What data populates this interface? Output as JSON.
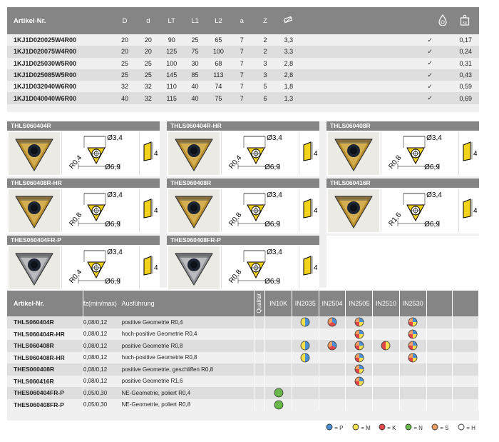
{
  "top_table": {
    "headers": [
      "Artikel-Nr.",
      "D",
      "d",
      "LT",
      "L1",
      "L2",
      "a",
      "Z"
    ],
    "rows": [
      [
        "1KJ1D020025W4R00",
        "20",
        "20",
        "90",
        "25",
        "65",
        "7",
        "2",
        "3,3",
        "✓",
        "0,17"
      ],
      [
        "1KJ1D020075W4R00",
        "20",
        "20",
        "125",
        "75",
        "100",
        "7",
        "2",
        "3,3",
        "✓",
        "0,24"
      ],
      [
        "1KJ1D025030W5R00",
        "25",
        "25",
        "100",
        "30",
        "68",
        "7",
        "3",
        "2,8",
        "✓",
        "0,31"
      ],
      [
        "1KJ1D025085W5R00",
        "25",
        "25",
        "145",
        "85",
        "113",
        "7",
        "3",
        "2,8",
        "✓",
        "0,43"
      ],
      [
        "1KJ1D032040W6R00",
        "32",
        "32",
        "110",
        "40",
        "74",
        "7",
        "5",
        "1,8",
        "✓",
        "0,59"
      ],
      [
        "1KJ1D040040W6R00",
        "40",
        "32",
        "115",
        "40",
        "75",
        "7",
        "6",
        "1,3",
        "✓",
        "0,69"
      ]
    ],
    "weight_icon_label": "kg"
  },
  "inserts": [
    {
      "name": "THLS060404R",
      "radius": "R0,4",
      "d1": "Ø3,4",
      "d2": "Ø6,9",
      "h": "4",
      "coating": "gold"
    },
    {
      "name": "THLS060404R-HR",
      "radius": "R0,4",
      "d1": "Ø3,4",
      "d2": "Ø6,9",
      "h": "4",
      "coating": "gold"
    },
    {
      "name": "THLS060408R",
      "radius": "R0,8",
      "d1": "Ø3,4",
      "d2": "Ø6,9",
      "h": "4",
      "coating": "gold"
    },
    {
      "name": "THLS060408R-HR",
      "radius": "R0,8",
      "d1": "Ø3,4",
      "d2": "Ø6,9",
      "h": "4",
      "coating": "gold"
    },
    {
      "name": "THES060408R",
      "radius": "R0,8",
      "d1": "Ø3,4",
      "d2": "Ø6,9",
      "h": "4",
      "coating": "gold"
    },
    {
      "name": "THLS060416R",
      "radius": "R1,6",
      "d1": "Ø3,4",
      "d2": "Ø6,9",
      "h": "4",
      "coating": "gold"
    },
    {
      "name": "THES060404FR-P",
      "radius": "R0,4",
      "d1": "Ø3,4",
      "d2": "Ø6,9",
      "h": "4",
      "coating": "silver"
    },
    {
      "name": "THES060408FR-P",
      "radius": "R0,8",
      "d1": "Ø3,4",
      "d2": "Ø6,9",
      "h": "4",
      "coating": "silver"
    }
  ],
  "bottom_table": {
    "headers": {
      "art": "Artikel-Nr.",
      "fz": "fz(min/max)",
      "ausf": "Ausführung",
      "qual": "Qualität"
    },
    "grades": [
      "IN10K",
      "IN2035",
      "IN2504",
      "IN2505",
      "IN2510",
      "IN2530",
      "",
      ""
    ],
    "rows": [
      {
        "art": "THLS060404R",
        "fz": "0,08/0,12",
        "ausf": "positive Geometrie R0,4",
        "dots": {
          "IN2035": "PM",
          "IN2504": "PKS",
          "IN2505": "PMKS",
          "IN2530": "PMKS"
        }
      },
      {
        "art": "THLS060404R-HR",
        "fz": "0,08/0,12",
        "ausf": "hoch-positive Geometrie R0,4",
        "dots": {
          "IN2505": "PMKS",
          "IN2530": "PMKS"
        }
      },
      {
        "art": "THLS060408R",
        "fz": "0,08/0,12",
        "ausf": "positive Geometrie R0,8",
        "dots": {
          "IN2035": "PM",
          "IN2504": "PKS",
          "IN2505": "PMKS",
          "IN2510": "MK",
          "IN2530": "PMKS"
        }
      },
      {
        "art": "THLS060408R-HR",
        "fz": "0,08/0,12",
        "ausf": "hoch-positive Geometrie R0,8",
        "dots": {
          "IN2035": "PM",
          "IN2505": "PMKS",
          "IN2530": "PMKS"
        }
      },
      {
        "art": "THES060408R",
        "fz": "0,08/0,12",
        "ausf": "positive Geometrie, geschliffen R0,8",
        "dots": {
          "IN2505": "PMKS"
        }
      },
      {
        "art": "THLS060416R",
        "fz": "0,08/0,12",
        "ausf": "positive Geometrie R1,6",
        "dots": {
          "IN2505": "PMKS"
        }
      },
      {
        "art": "THES060404FR-P",
        "fz": "0,05/0,30",
        "ausf": "NE-Geometrie, poliert R0,4",
        "dots": {
          "IN10K": "N"
        }
      },
      {
        "art": "THES060408FR-P",
        "fz": "0,05/0,30",
        "ausf": "NE-Geometrie, poliert R0,8",
        "dots": {
          "IN10K": "N"
        }
      }
    ]
  },
  "legend": [
    {
      "key": "P",
      "label": "= P",
      "color": "#4a8fd6"
    },
    {
      "key": "M",
      "label": "= M",
      "color": "#f4e04a"
    },
    {
      "key": "K",
      "label": "= K",
      "color": "#e2454a"
    },
    {
      "key": "N",
      "label": "= N",
      "color": "#6ab84a"
    },
    {
      "key": "S",
      "label": "= S",
      "color": "#f0a060"
    },
    {
      "key": "H",
      "label": "= H",
      "color": "#ffffff"
    }
  ]
}
